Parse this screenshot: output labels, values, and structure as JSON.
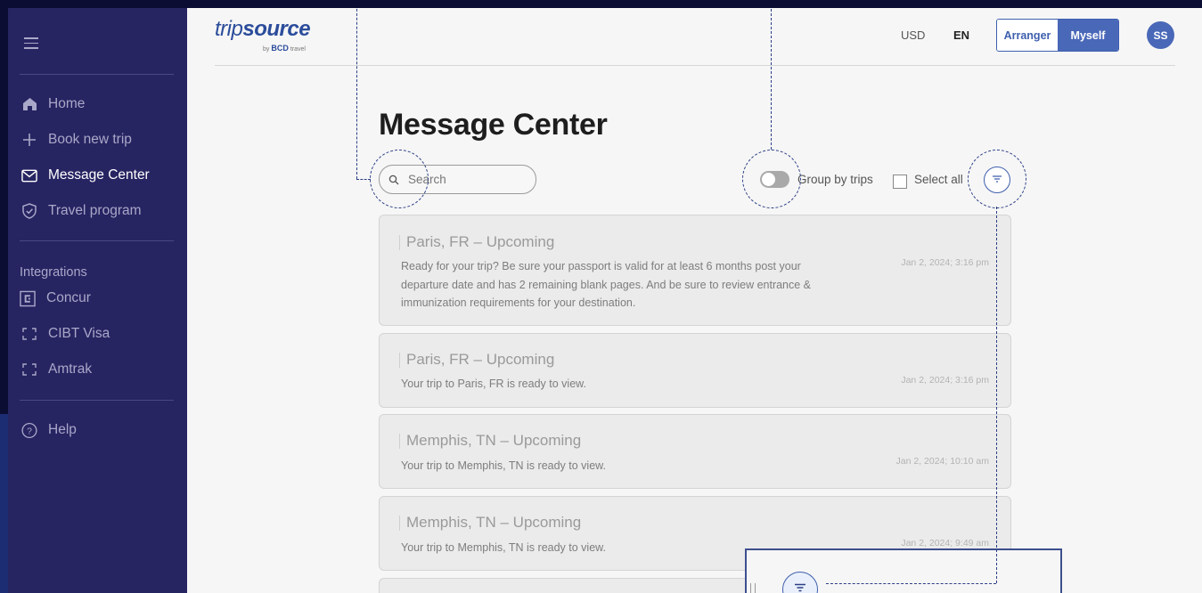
{
  "sidebar": {
    "items": [
      {
        "label": "Home",
        "icon": "home-icon"
      },
      {
        "label": "Book new trip",
        "icon": "plus-icon"
      },
      {
        "label": "Message Center",
        "icon": "mail-icon",
        "active": true
      },
      {
        "label": "Travel program",
        "icon": "shield-check-icon"
      }
    ],
    "integrations_heading": "Integrations",
    "integrations": [
      {
        "label": "Concur",
        "icon": "concur-icon"
      },
      {
        "label": "CIBT Visa",
        "icon": "bracket-frame-icon"
      },
      {
        "label": "Amtrak",
        "icon": "bracket-frame-icon"
      }
    ],
    "help_label": "Help"
  },
  "header": {
    "logo_text_light": "trip",
    "logo_text_bold": "source",
    "logo_by": "by",
    "logo_bcd": "BCD",
    "logo_travel": "travel",
    "currency": "USD",
    "language": "EN",
    "role_options": [
      "Arranger",
      "Myself"
    ],
    "role_selected": "Myself",
    "avatar_initials": "SS"
  },
  "main": {
    "title": "Message Center",
    "search_placeholder": "Search",
    "group_by_label": "Group by trips",
    "group_by_enabled": false,
    "select_all_label": "Select all",
    "select_all_checked": false,
    "messages": [
      {
        "title": "Paris, FR – Upcoming",
        "body": "Ready for your trip? Be sure your passport is valid for at least 6 months post your departure date and has 2 remaining blank pages. And be sure to review entrance & immunization requirements for your destination.",
        "date": "Jan 2, 2024; 3:16 pm"
      },
      {
        "title": "Paris, FR – Upcoming",
        "body": "Your trip to Paris, FR is ready to view.",
        "date": "Jan 2, 2024; 3:16 pm"
      },
      {
        "title": "Memphis, TN – Upcoming",
        "body": "Your trip to Memphis, TN is ready to view.",
        "date": "Jan 2, 2024; 10:10 am"
      },
      {
        "title": "Memphis, TN – Upcoming",
        "body": "Your trip to Memphis, TN is ready to view.",
        "date": "Jan 2, 2024; 9:49 am"
      }
    ]
  },
  "colors": {
    "sidebar_bg": "#272462",
    "brand_blue": "#4a68b8",
    "annotation": "#2b3f86"
  }
}
